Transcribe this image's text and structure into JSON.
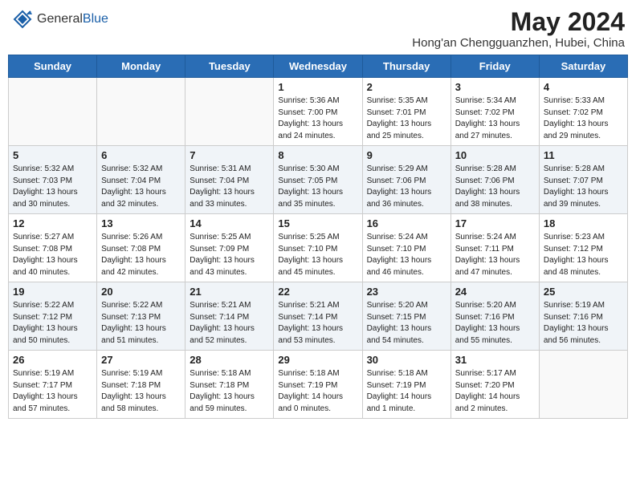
{
  "header": {
    "logo_general": "General",
    "logo_blue": "Blue",
    "month_year": "May 2024",
    "location": "Hong'an Chengguanzhen, Hubei, China"
  },
  "days_of_week": [
    "Sunday",
    "Monday",
    "Tuesday",
    "Wednesday",
    "Thursday",
    "Friday",
    "Saturday"
  ],
  "weeks": [
    [
      {
        "day": "",
        "sunrise": "",
        "sunset": "",
        "daylight": ""
      },
      {
        "day": "",
        "sunrise": "",
        "sunset": "",
        "daylight": ""
      },
      {
        "day": "",
        "sunrise": "",
        "sunset": "",
        "daylight": ""
      },
      {
        "day": "1",
        "sunrise": "Sunrise: 5:36 AM",
        "sunset": "Sunset: 7:00 PM",
        "daylight": "Daylight: 13 hours and 24 minutes."
      },
      {
        "day": "2",
        "sunrise": "Sunrise: 5:35 AM",
        "sunset": "Sunset: 7:01 PM",
        "daylight": "Daylight: 13 hours and 25 minutes."
      },
      {
        "day": "3",
        "sunrise": "Sunrise: 5:34 AM",
        "sunset": "Sunset: 7:02 PM",
        "daylight": "Daylight: 13 hours and 27 minutes."
      },
      {
        "day": "4",
        "sunrise": "Sunrise: 5:33 AM",
        "sunset": "Sunset: 7:02 PM",
        "daylight": "Daylight: 13 hours and 29 minutes."
      }
    ],
    [
      {
        "day": "5",
        "sunrise": "Sunrise: 5:32 AM",
        "sunset": "Sunset: 7:03 PM",
        "daylight": "Daylight: 13 hours and 30 minutes."
      },
      {
        "day": "6",
        "sunrise": "Sunrise: 5:32 AM",
        "sunset": "Sunset: 7:04 PM",
        "daylight": "Daylight: 13 hours and 32 minutes."
      },
      {
        "day": "7",
        "sunrise": "Sunrise: 5:31 AM",
        "sunset": "Sunset: 7:04 PM",
        "daylight": "Daylight: 13 hours and 33 minutes."
      },
      {
        "day": "8",
        "sunrise": "Sunrise: 5:30 AM",
        "sunset": "Sunset: 7:05 PM",
        "daylight": "Daylight: 13 hours and 35 minutes."
      },
      {
        "day": "9",
        "sunrise": "Sunrise: 5:29 AM",
        "sunset": "Sunset: 7:06 PM",
        "daylight": "Daylight: 13 hours and 36 minutes."
      },
      {
        "day": "10",
        "sunrise": "Sunrise: 5:28 AM",
        "sunset": "Sunset: 7:06 PM",
        "daylight": "Daylight: 13 hours and 38 minutes."
      },
      {
        "day": "11",
        "sunrise": "Sunrise: 5:28 AM",
        "sunset": "Sunset: 7:07 PM",
        "daylight": "Daylight: 13 hours and 39 minutes."
      }
    ],
    [
      {
        "day": "12",
        "sunrise": "Sunrise: 5:27 AM",
        "sunset": "Sunset: 7:08 PM",
        "daylight": "Daylight: 13 hours and 40 minutes."
      },
      {
        "day": "13",
        "sunrise": "Sunrise: 5:26 AM",
        "sunset": "Sunset: 7:08 PM",
        "daylight": "Daylight: 13 hours and 42 minutes."
      },
      {
        "day": "14",
        "sunrise": "Sunrise: 5:25 AM",
        "sunset": "Sunset: 7:09 PM",
        "daylight": "Daylight: 13 hours and 43 minutes."
      },
      {
        "day": "15",
        "sunrise": "Sunrise: 5:25 AM",
        "sunset": "Sunset: 7:10 PM",
        "daylight": "Daylight: 13 hours and 45 minutes."
      },
      {
        "day": "16",
        "sunrise": "Sunrise: 5:24 AM",
        "sunset": "Sunset: 7:10 PM",
        "daylight": "Daylight: 13 hours and 46 minutes."
      },
      {
        "day": "17",
        "sunrise": "Sunrise: 5:24 AM",
        "sunset": "Sunset: 7:11 PM",
        "daylight": "Daylight: 13 hours and 47 minutes."
      },
      {
        "day": "18",
        "sunrise": "Sunrise: 5:23 AM",
        "sunset": "Sunset: 7:12 PM",
        "daylight": "Daylight: 13 hours and 48 minutes."
      }
    ],
    [
      {
        "day": "19",
        "sunrise": "Sunrise: 5:22 AM",
        "sunset": "Sunset: 7:12 PM",
        "daylight": "Daylight: 13 hours and 50 minutes."
      },
      {
        "day": "20",
        "sunrise": "Sunrise: 5:22 AM",
        "sunset": "Sunset: 7:13 PM",
        "daylight": "Daylight: 13 hours and 51 minutes."
      },
      {
        "day": "21",
        "sunrise": "Sunrise: 5:21 AM",
        "sunset": "Sunset: 7:14 PM",
        "daylight": "Daylight: 13 hours and 52 minutes."
      },
      {
        "day": "22",
        "sunrise": "Sunrise: 5:21 AM",
        "sunset": "Sunset: 7:14 PM",
        "daylight": "Daylight: 13 hours and 53 minutes."
      },
      {
        "day": "23",
        "sunrise": "Sunrise: 5:20 AM",
        "sunset": "Sunset: 7:15 PM",
        "daylight": "Daylight: 13 hours and 54 minutes."
      },
      {
        "day": "24",
        "sunrise": "Sunrise: 5:20 AM",
        "sunset": "Sunset: 7:16 PM",
        "daylight": "Daylight: 13 hours and 55 minutes."
      },
      {
        "day": "25",
        "sunrise": "Sunrise: 5:19 AM",
        "sunset": "Sunset: 7:16 PM",
        "daylight": "Daylight: 13 hours and 56 minutes."
      }
    ],
    [
      {
        "day": "26",
        "sunrise": "Sunrise: 5:19 AM",
        "sunset": "Sunset: 7:17 PM",
        "daylight": "Daylight: 13 hours and 57 minutes."
      },
      {
        "day": "27",
        "sunrise": "Sunrise: 5:19 AM",
        "sunset": "Sunset: 7:18 PM",
        "daylight": "Daylight: 13 hours and 58 minutes."
      },
      {
        "day": "28",
        "sunrise": "Sunrise: 5:18 AM",
        "sunset": "Sunset: 7:18 PM",
        "daylight": "Daylight: 13 hours and 59 minutes."
      },
      {
        "day": "29",
        "sunrise": "Sunrise: 5:18 AM",
        "sunset": "Sunset: 7:19 PM",
        "daylight": "Daylight: 14 hours and 0 minutes."
      },
      {
        "day": "30",
        "sunrise": "Sunrise: 5:18 AM",
        "sunset": "Sunset: 7:19 PM",
        "daylight": "Daylight: 14 hours and 1 minute."
      },
      {
        "day": "31",
        "sunrise": "Sunrise: 5:17 AM",
        "sunset": "Sunset: 7:20 PM",
        "daylight": "Daylight: 14 hours and 2 minutes."
      },
      {
        "day": "",
        "sunrise": "",
        "sunset": "",
        "daylight": ""
      }
    ]
  ]
}
